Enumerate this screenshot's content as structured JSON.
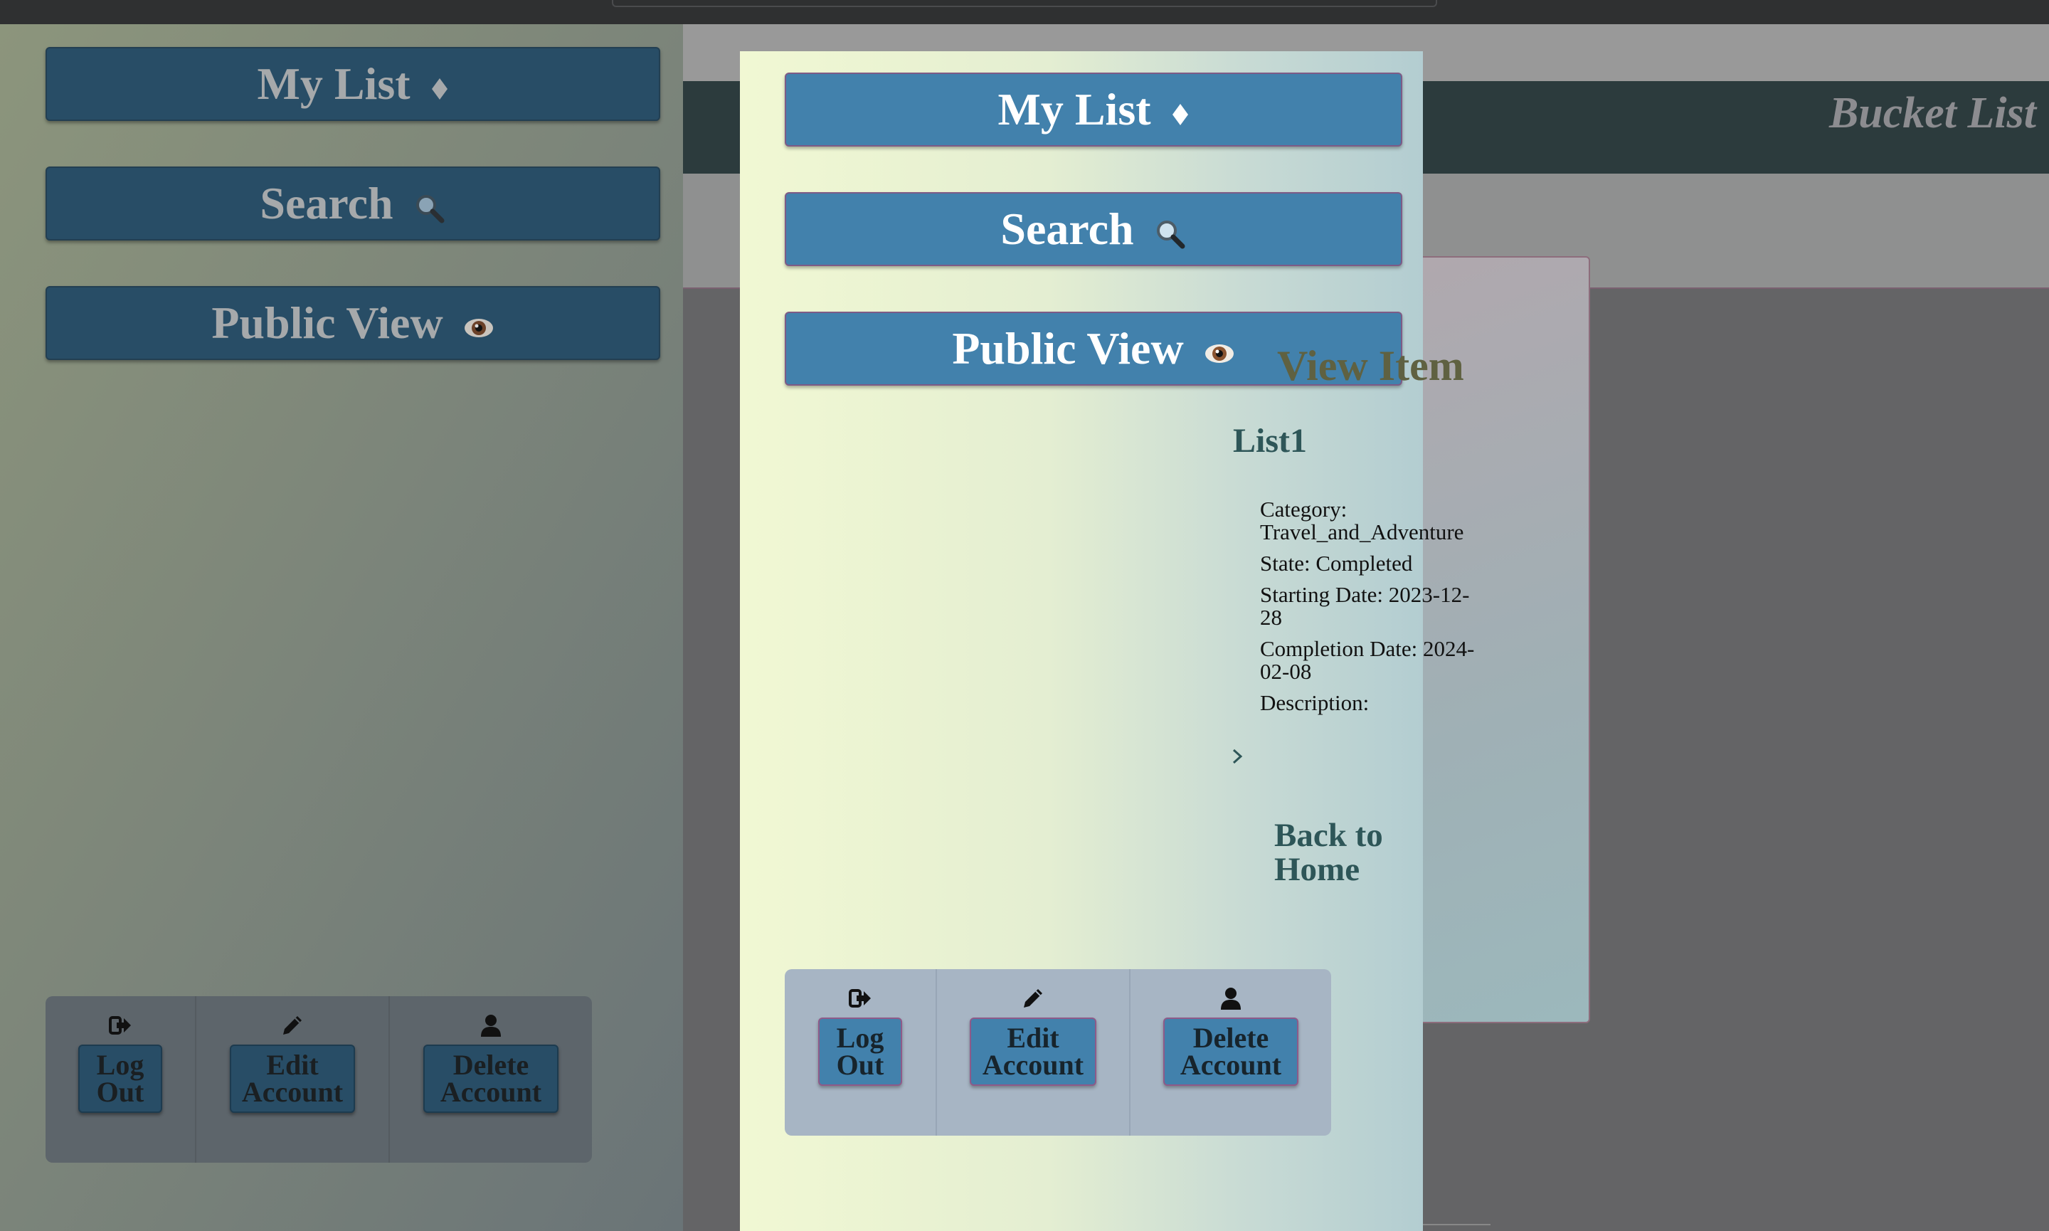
{
  "app": {
    "title": "Bucket List"
  },
  "nav": {
    "my_list": "My List",
    "search": "Search",
    "public_view": "Public View"
  },
  "icons": {
    "my_list": "diamond-icon",
    "search": "magnifier-icon",
    "public_view": "eye-icon",
    "log_out": "sign-out-icon",
    "edit_account": "pencil-icon",
    "delete_account": "user-icon"
  },
  "account": {
    "log_out": "Log Out",
    "edit": "Edit Account",
    "delete": "Delete Account"
  },
  "item_view": {
    "heading": "View Item",
    "name": "List1",
    "category": "Category: Travel_and_Adventure",
    "state": "State: Completed",
    "starting_date": "Starting Date: 2023-12-28",
    "completion_date": "Completion Date: 2024-02-08",
    "description": "Description:",
    "back_link": "Back to Home"
  },
  "colors": {
    "button": "#4281ac",
    "header": "#2c3b3d",
    "heading": "#2e5658"
  }
}
